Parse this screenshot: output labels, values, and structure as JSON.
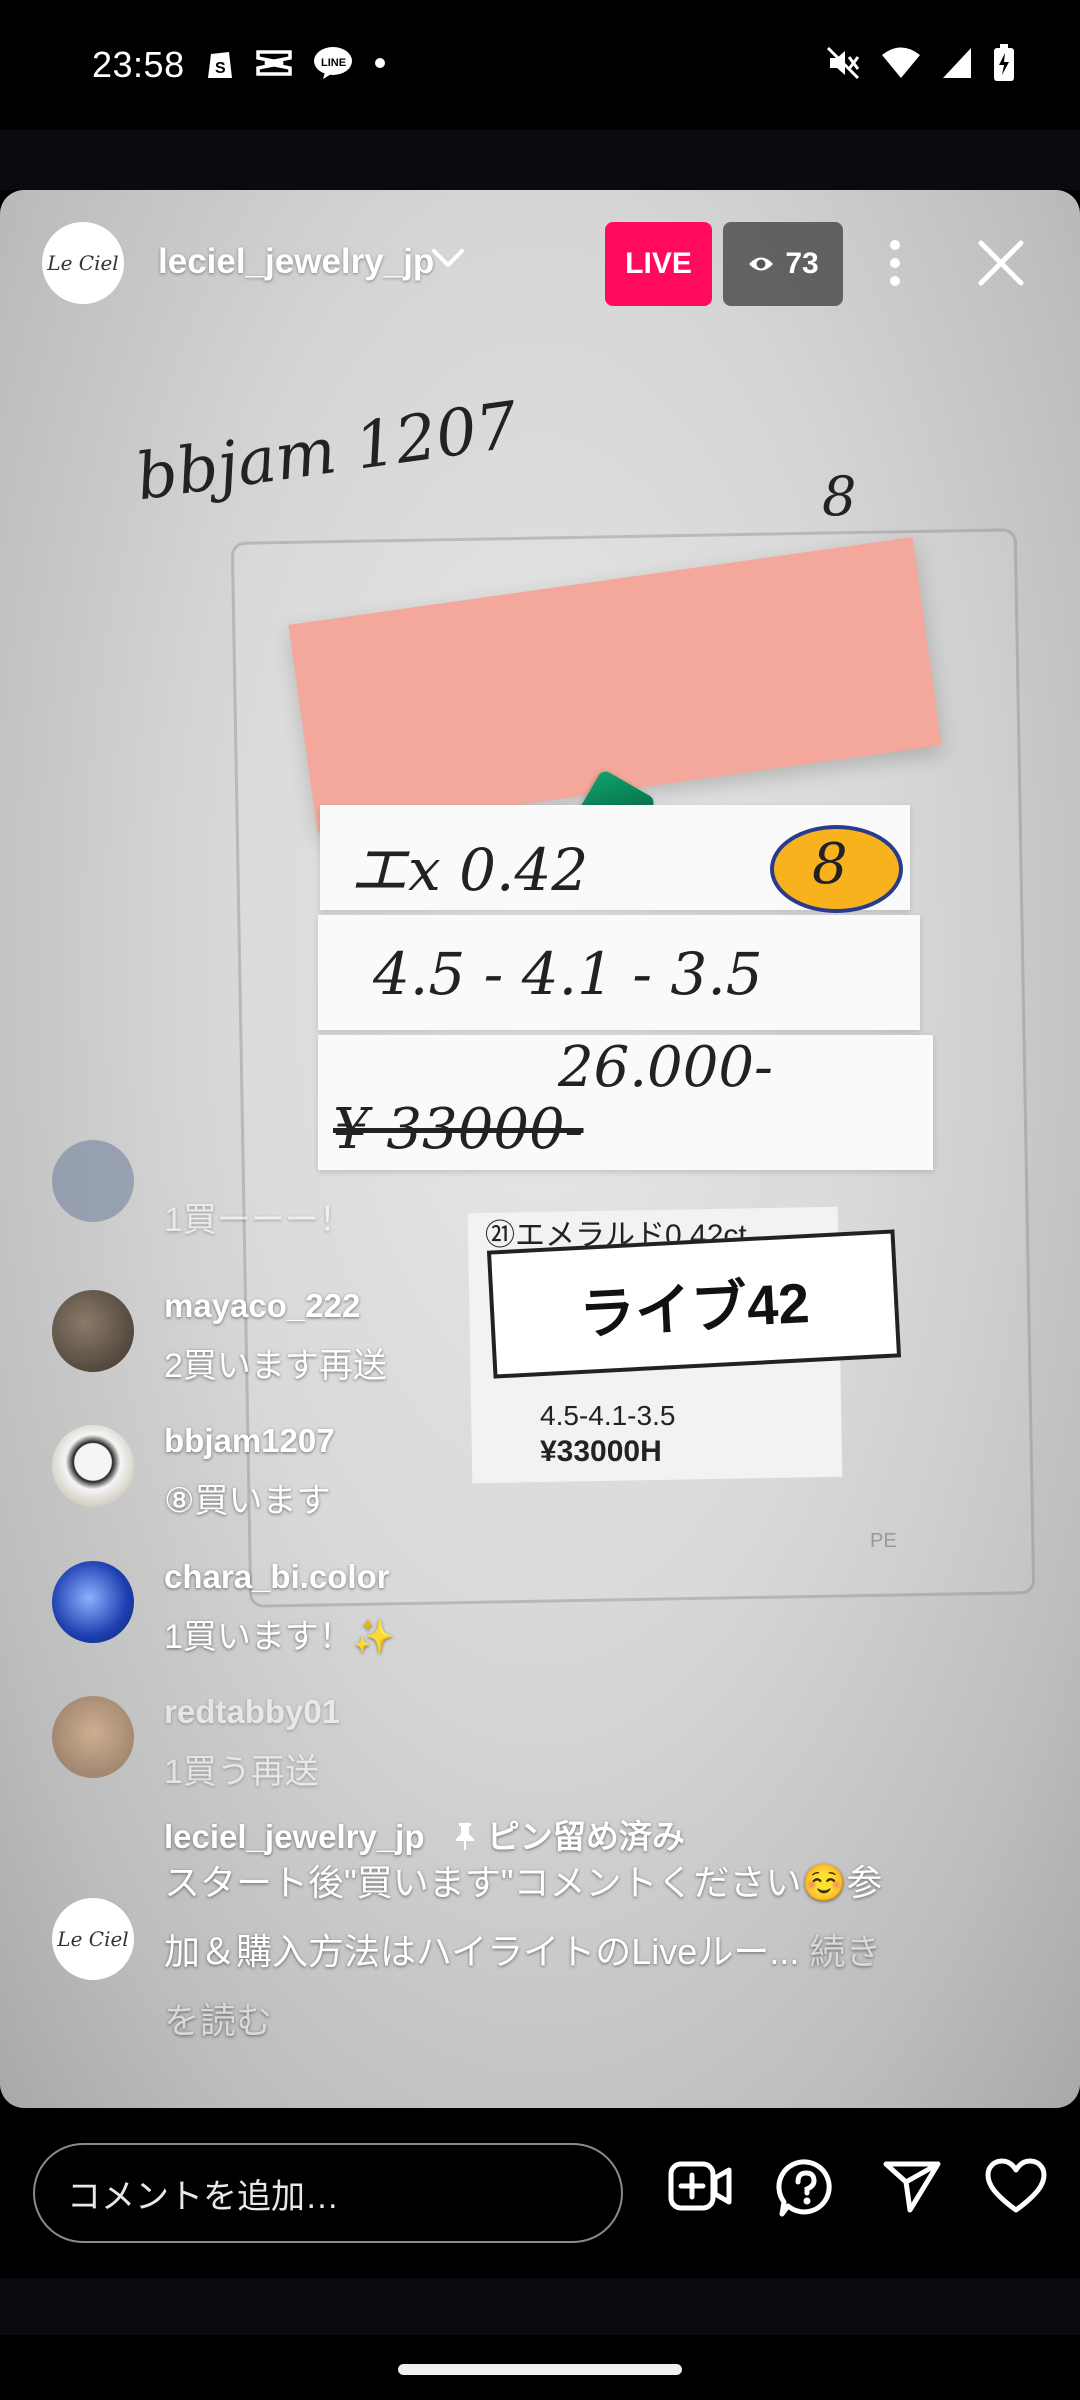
{
  "status_bar": {
    "time": "23:58",
    "left_icons": [
      "shopify-icon",
      "capcut-icon",
      "line-icon",
      "dot-icon"
    ],
    "right_icons": [
      "mute-icon",
      "wifi-icon",
      "signal-icon",
      "battery-charging-icon"
    ]
  },
  "header": {
    "host_username": "leciel_jewelry_jp",
    "logo_text": "Le Ciel",
    "live_label": "LIVE",
    "viewer_count": "73"
  },
  "video_scene": {
    "note_text": "bbjam 1207",
    "note_number": "8",
    "strip1": "エx  0.42",
    "strip1_badge": "8",
    "strip2": "4.5 - 4.1 - 3.5",
    "strip3_new_price": "26.000-",
    "strip3_old_price": "¥ 33000-",
    "card_title": "㉑エメラルド0.42ct",
    "card_label": "ライブ42",
    "card_dims": "4.5-4.1-3.5",
    "card_price": "¥33000H",
    "card_mark": "PE"
  },
  "comments": [
    {
      "user": "",
      "text": "1買ーーー！",
      "faded": true
    },
    {
      "user": "mayaco_222",
      "text": "2買います再送",
      "faded": false
    },
    {
      "user": "bbjam1207",
      "text": "⑧買います",
      "faded": false
    },
    {
      "user": "chara_bi.color",
      "text": "1買います！✨",
      "faded": false
    },
    {
      "user": "redtabby01",
      "text": "1買う再送",
      "faded": true
    }
  ],
  "pinned": {
    "user": "leciel_jewelry_jp",
    "pinned_label": "ピン留め済み",
    "text": "スタート後\"買います\"コメントください☺️参加＆購入方法はハイライトのLiveルー...",
    "more": "続きを読む"
  },
  "bottom_bar": {
    "comment_placeholder": "コメントを追加…",
    "icons": [
      "add-video-icon",
      "question-icon",
      "send-icon",
      "heart-icon"
    ]
  }
}
